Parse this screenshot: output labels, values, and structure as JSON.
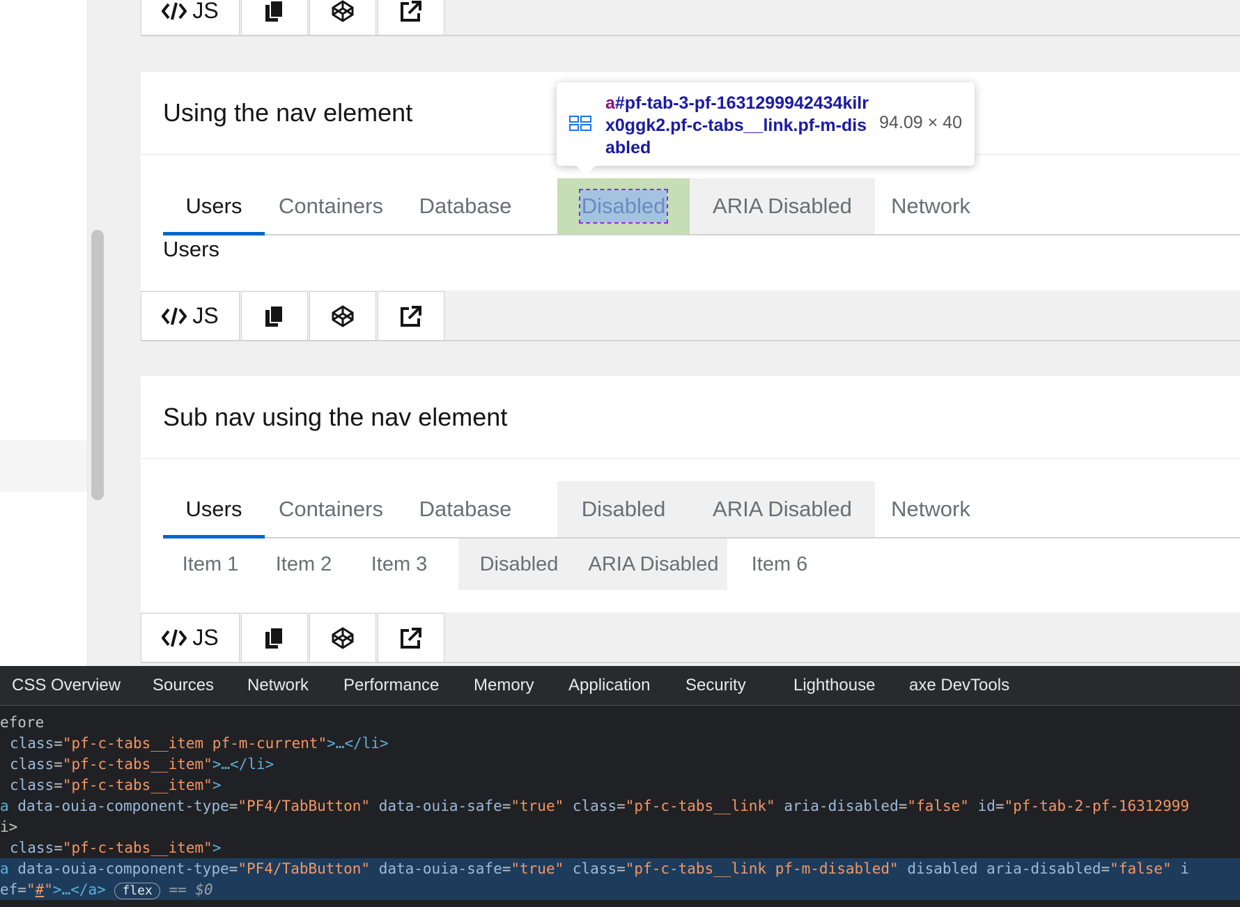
{
  "toolbar": {
    "js_label": "JS"
  },
  "section_nav": {
    "title": "Using the nav element",
    "tabs": [
      "Users",
      "Containers",
      "Database",
      "Disabled",
      "ARIA Disabled",
      "Network"
    ],
    "panel_text": "Users"
  },
  "section_subnav": {
    "title": "Sub nav using the nav element",
    "tabs": [
      "Users",
      "Containers",
      "Database",
      "Disabled",
      "ARIA Disabled",
      "Network"
    ],
    "subtabs": [
      "Item 1",
      "Item 2",
      "Item 3",
      "Disabled",
      "ARIA Disabled",
      "Item 6"
    ]
  },
  "tooltip": {
    "tag": "a",
    "selector": "#pf-tab-3-pf-1631299942434kilrx0ggk2.pf-c-tabs__link.pf-m-disabled",
    "size": "94.09 × 40"
  },
  "devtools": {
    "tabs": [
      "CSS Overview",
      "Sources",
      "Network",
      "Performance",
      "Memory",
      "Application",
      "Security",
      "Lighthouse",
      "axe DevTools"
    ],
    "lines": {
      "l0": "efore",
      "l1_class": "\"pf-c-tabs__item pf-m-current\"",
      "l2_class": "\"pf-c-tabs__item\"",
      "l3_class": "\"pf-c-tabs__item\"",
      "l4_type": "\"PF4/TabButton\"",
      "l4_safe": "\"true\"",
      "l4_class": "\"pf-c-tabs__link\"",
      "l4_aria": "\"false\"",
      "l4_id": "\"pf-tab-2-pf-16312999",
      "l6_class": "\"pf-c-tabs__item\"",
      "l7_type": "\"PF4/TabButton\"",
      "l7_safe": "\"true\"",
      "l7_class": "\"pf-c-tabs__link pf-m-disabled\"",
      "l7_aria": "\"false\"",
      "badge": "flex",
      "eq": "== $0"
    }
  }
}
